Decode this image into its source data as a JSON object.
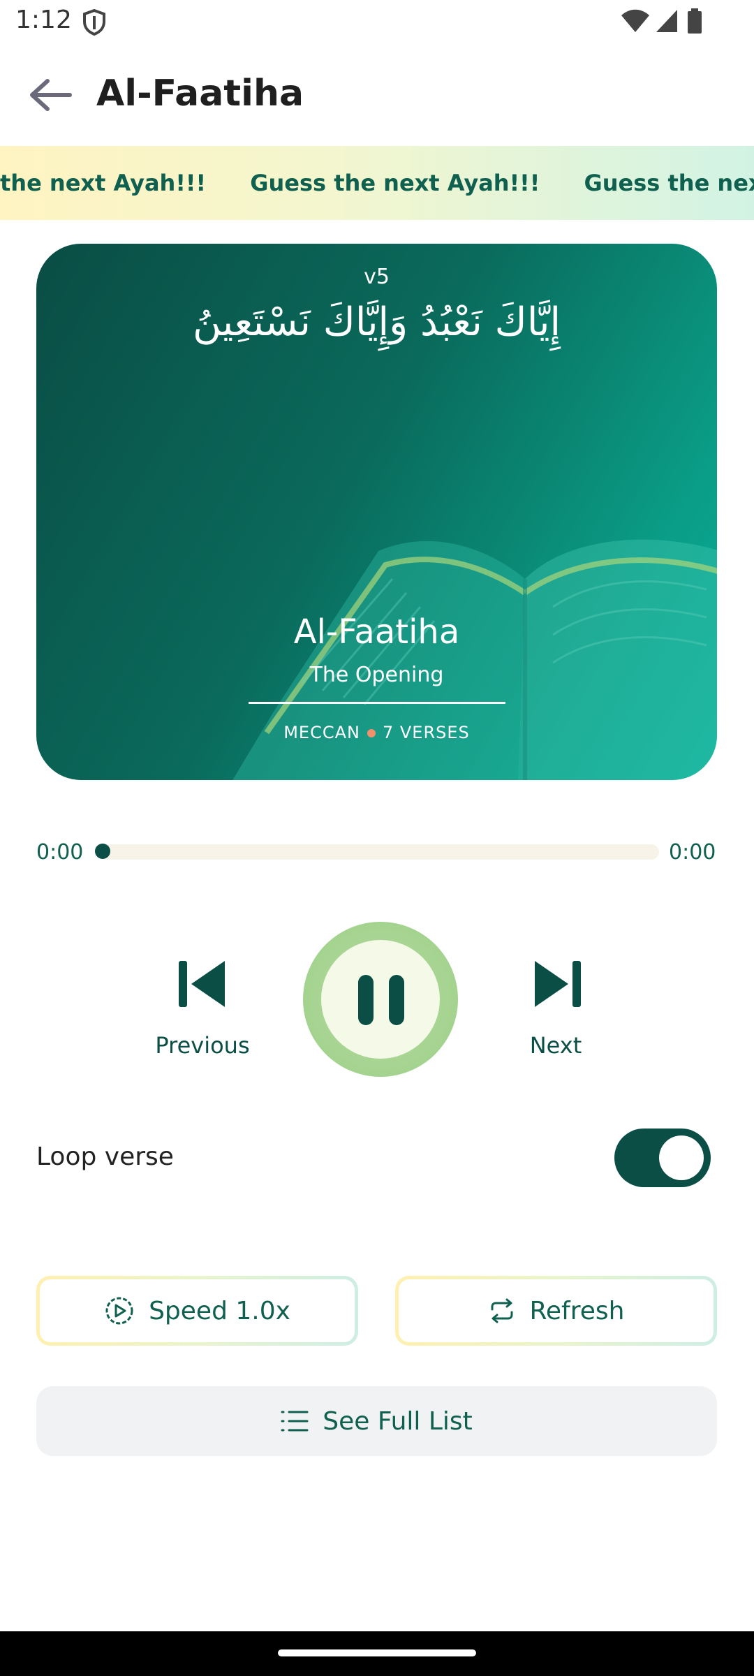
{
  "status_bar": {
    "time": "1:12"
  },
  "app_bar": {
    "title": "Al-Faatiha"
  },
  "banner": {
    "items": [
      "Guess the next Ayah!!!",
      "Guess the next Ayah!!!",
      "Guess the next Ayah!!!"
    ]
  },
  "card": {
    "verse_label": "v5",
    "arabic_text": "إِيَّاكَ نَعْبُدُ وَإِيَّاكَ نَسْتَعِينُ",
    "surah_name": "Al-Faatiha",
    "surah_translation": "The Opening",
    "revelation": "MECCAN",
    "verse_count": "7 VERSES"
  },
  "player": {
    "elapsed": "0:00",
    "duration": "0:00",
    "progress": 0,
    "previous_label": "Previous",
    "next_label": "Next"
  },
  "loop": {
    "label": "Loop verse",
    "enabled": true
  },
  "buttons": {
    "speed_label": "Speed 1.0x",
    "refresh_label": "Refresh",
    "list_label": "See Full List"
  },
  "colors": {
    "primary": "#0b4e45",
    "accent_light": "#9ccf88",
    "card_gradient_end": "#07b19a"
  }
}
